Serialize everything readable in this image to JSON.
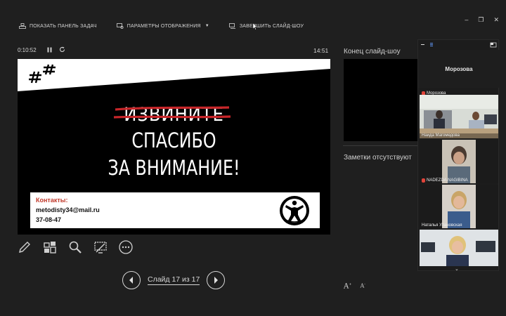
{
  "toolbar": {
    "taskbar_label": "ПОКАЗАТЬ ПАНЕЛЬ ЗАДАЧ",
    "display_label": "ПАРАМЕТРЫ ОТОБРАЖЕНИЯ",
    "end_label": "ЗАВЕРШИТЬ СЛАЙД-ШОУ"
  },
  "window_controls": {
    "minimize": "–",
    "restore": "❐",
    "close": "✕"
  },
  "presenter": {
    "timer": "0:10:52",
    "clock": "14:51",
    "pause_icon": "pause-icon",
    "restart_icon": "restart-icon"
  },
  "slide": {
    "struck_text": "ИЗВИНИТЕ",
    "line1": "СПАСИБО",
    "line2": "ЗА ВНИМАНИЕ!",
    "contacts_title": "Контакты:",
    "email": "metodisty34@mail.ru",
    "phone": "37-08-47"
  },
  "navigation": {
    "slide_label": "Слайд 17 из 17",
    "prev_icon": "chevron-left-icon",
    "next_icon": "chevron-right-icon"
  },
  "tools": [
    "pen-icon",
    "slides-grid-icon",
    "zoom-icon",
    "screen-icon",
    "more-icon"
  ],
  "right": {
    "next_title": "Конец слайд-шоу",
    "notes": "Заметки отсутствуют"
  },
  "video": {
    "host": "Морозова",
    "participants": [
      {
        "name": "Морозова"
      },
      {
        "name": "Наида Магомедова"
      },
      {
        "name": "NADEZDA NAGIBINA"
      },
      {
        "name": "Наталья Улановская"
      },
      {
        "name": ""
      }
    ]
  },
  "colors": {
    "background": "#1f1f1f",
    "slide_bg": "#000000",
    "accent_red": "#c0392b",
    "mic_red": "#e0443a"
  }
}
